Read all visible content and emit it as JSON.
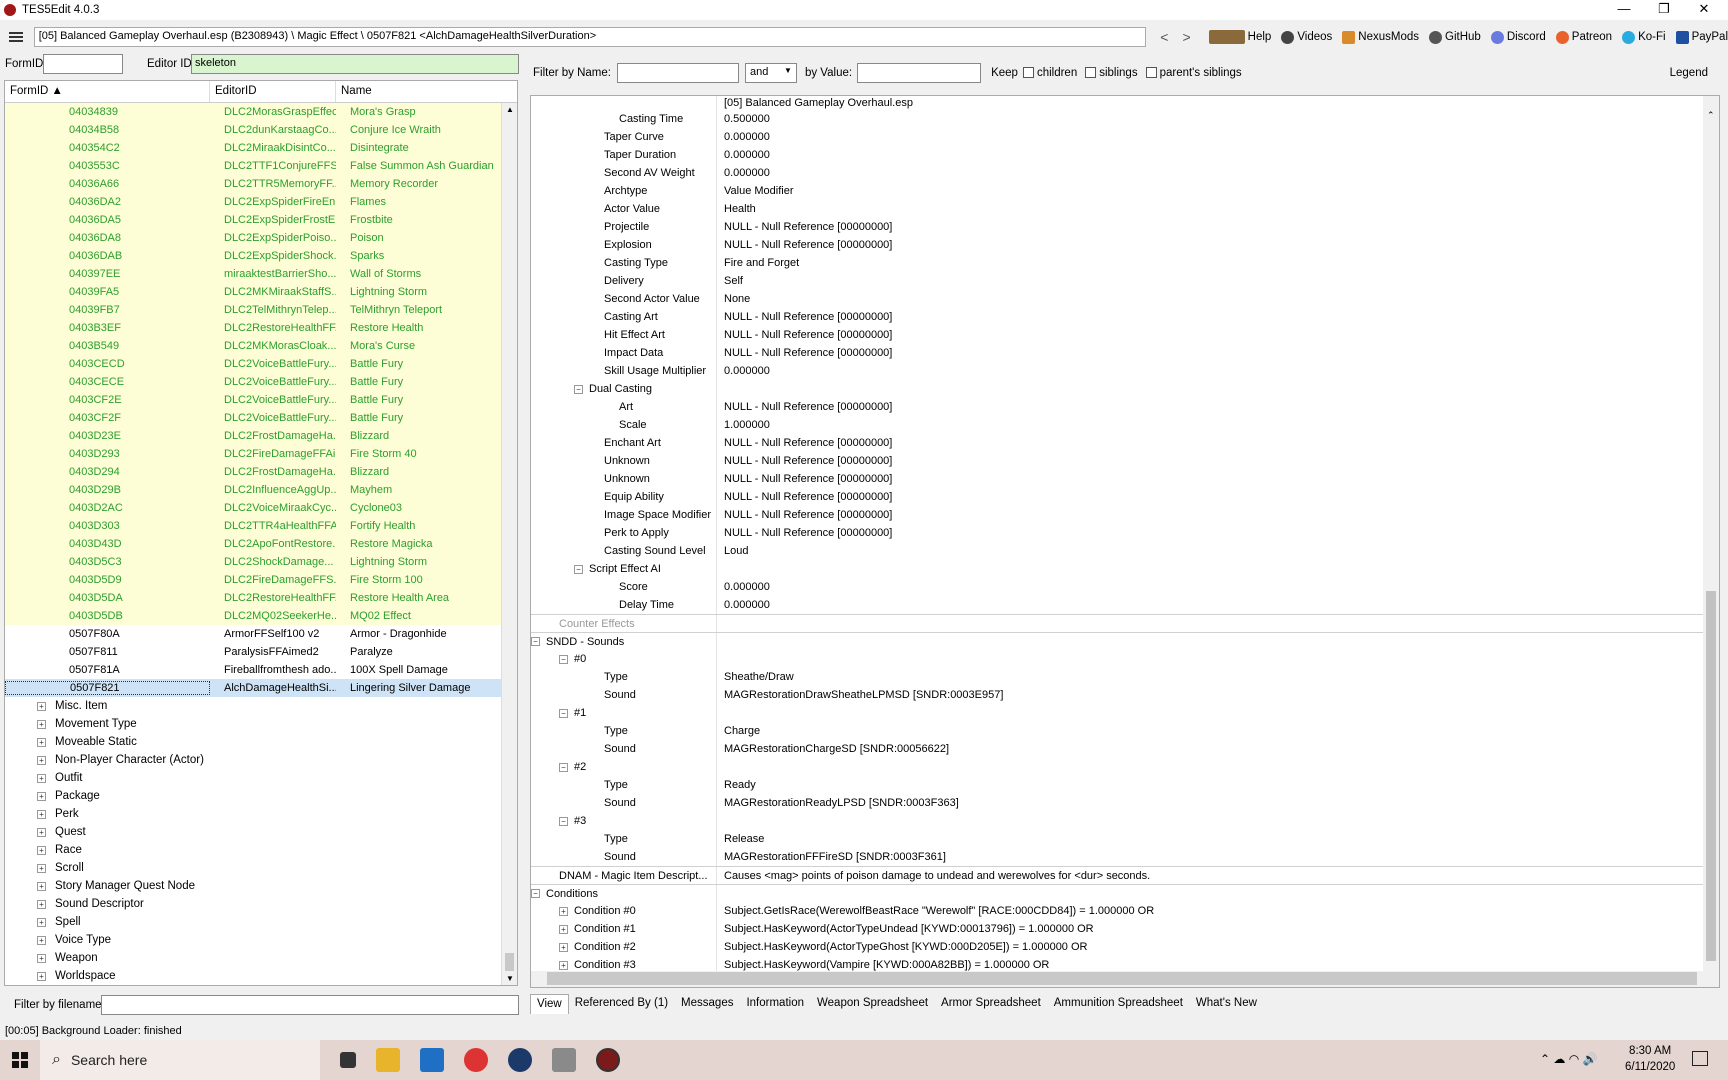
{
  "window": {
    "title": "TES5Edit 4.0.3"
  },
  "pathbar": {
    "path": "[05] Balanced Gameplay Overhaul.esp (B2308943) \\ Magic Effect \\ 0507F821 <AlchDamageHealthSilverDuration>"
  },
  "toolbar": {
    "links": [
      "Help",
      "Videos",
      "NexusMods",
      "GitHub",
      "Discord",
      "Patreon",
      "Ko-Fi",
      "PayPal"
    ]
  },
  "filters": {
    "formid_label": "FormID",
    "editorid_label": "Editor ID",
    "editorid_value": "skeleton",
    "filename_label": "Filter by filename:"
  },
  "tree": {
    "headers": [
      "FormID",
      "EditorID",
      "Name"
    ],
    "rows": [
      [
        "04034839",
        "DLC2MorasGraspEffect",
        "Mora's Grasp"
      ],
      [
        "04034B58",
        "DLC2dunKarstaagCo...",
        "Conjure Ice Wraith"
      ],
      [
        "040354C2",
        "DLC2MiraakDisintCo...",
        "Disintegrate"
      ],
      [
        "0403553C",
        "DLC2TTF1ConjureFFS...",
        "False Summon Ash Guardian"
      ],
      [
        "04036A66",
        "DLC2TTR5MemoryFF...",
        "Memory Recorder"
      ],
      [
        "04036DA2",
        "DLC2ExpSpiderFireEn...",
        "Flames"
      ],
      [
        "04036DA5",
        "DLC2ExpSpiderFrostE...",
        "Frostbite"
      ],
      [
        "04036DA8",
        "DLC2ExpSpiderPoiso...",
        "Poison"
      ],
      [
        "04036DAB",
        "DLC2ExpSpiderShock...",
        "Sparks"
      ],
      [
        "040397EE",
        "miraaktestBarrierSho...",
        "Wall of Storms"
      ],
      [
        "04039FA5",
        "DLC2MKMiraakStaffS...",
        "Lightning Storm"
      ],
      [
        "04039FB7",
        "DLC2TelMithrynTelep...",
        "TelMithryn Teleport"
      ],
      [
        "0403B3EF",
        "DLC2RestoreHealthFF...",
        "Restore Health"
      ],
      [
        "0403B549",
        "DLC2MKMorasCloak...",
        "Mora's Curse"
      ],
      [
        "0403CECD",
        "DLC2VoiceBattleFury...",
        "Battle Fury"
      ],
      [
        "0403CECE",
        "DLC2VoiceBattleFury...",
        "Battle Fury"
      ],
      [
        "0403CF2E",
        "DLC2VoiceBattleFury...",
        "Battle Fury"
      ],
      [
        "0403CF2F",
        "DLC2VoiceBattleFury...",
        "Battle Fury"
      ],
      [
        "0403D23E",
        "DLC2FrostDamageHa...",
        "Blizzard"
      ],
      [
        "0403D293",
        "DLC2FireDamageFFAi...",
        "Fire Storm 40"
      ],
      [
        "0403D294",
        "DLC2FrostDamageHa...",
        "Blizzard"
      ],
      [
        "0403D29B",
        "DLC2InfluenceAggUp...",
        "Mayhem"
      ],
      [
        "0403D2AC",
        "DLC2VoiceMiraakCyc...",
        "Cyclone03"
      ],
      [
        "0403D303",
        "DLC2TTR4aHealthFFA...",
        "Fortify Health"
      ],
      [
        "0403D43D",
        "DLC2ApoFontRestore...",
        "Restore Magicka"
      ],
      [
        "0403D5C3",
        "DLC2ShockDamage...",
        "Lightning Storm"
      ],
      [
        "0403D5D9",
        "DLC2FireDamageFFS...",
        "Fire Storm 100"
      ],
      [
        "0403D5DA",
        "DLC2RestoreHealthFF...",
        "Restore Health Area"
      ],
      [
        "0403D5DB",
        "DLC2MQ02SeekerHe...",
        "MQ02 Effect"
      ]
    ],
    "plain_rows": [
      [
        "0507F80A",
        "ArmorFFSelf100 v2",
        "Armor - Dragonhide"
      ],
      [
        "0507F811",
        "ParalysisFFAimed2",
        "Paralyze"
      ],
      [
        "0507F81A",
        "Fireballfromthesh ado...",
        "100X Spell Damage"
      ]
    ],
    "selected_row": [
      "0507F821",
      "AlchDamageHealthSi...",
      "Lingering Silver Damage"
    ],
    "groups": [
      "Misc. Item",
      "Movement Type",
      "Moveable Static",
      "Non-Player Character (Actor)",
      "Outfit",
      "Package",
      "Perk",
      "Quest",
      "Race",
      "Scroll",
      "Story Manager Quest Node",
      "Sound Descriptor",
      "Spell",
      "Voice Type",
      "Weapon",
      "Worldspace"
    ]
  },
  "rightfilter": {
    "by_name": "Filter by Name:",
    "op": "and",
    "by_value": "by Value:",
    "keep": "Keep",
    "children": "children",
    "siblings": "siblings",
    "parents_siblings": "parent's siblings",
    "legend": "Legend"
  },
  "props": {
    "file_header": "[05] Balanced Gameplay Overhaul.esp",
    "rows": [
      {
        "k": "Casting Time",
        "v": "0.500000",
        "i": 2
      },
      {
        "k": "Taper Curve",
        "v": "0.000000",
        "i": 1
      },
      {
        "k": "Taper Duration",
        "v": "0.000000",
        "i": 1
      },
      {
        "k": "Second AV Weight",
        "v": "0.000000",
        "i": 1
      },
      {
        "k": "Archtype",
        "v": "Value Modifier",
        "i": 1
      },
      {
        "k": "Actor Value",
        "v": "Health",
        "i": 1
      },
      {
        "k": "Projectile",
        "v": "NULL - Null Reference [00000000]",
        "i": 1
      },
      {
        "k": "Explosion",
        "v": "NULL - Null Reference [00000000]",
        "i": 1
      },
      {
        "k": "Casting Type",
        "v": "Fire and Forget",
        "i": 1
      },
      {
        "k": "Delivery",
        "v": "Self",
        "i": 1
      },
      {
        "k": "Second Actor Value",
        "v": "None",
        "i": 1
      },
      {
        "k": "Casting Art",
        "v": "NULL - Null Reference [00000000]",
        "i": 1
      },
      {
        "k": "Hit Effect Art",
        "v": "NULL - Null Reference [00000000]",
        "i": 1
      },
      {
        "k": "Impact Data",
        "v": "NULL - Null Reference [00000000]",
        "i": 1
      },
      {
        "k": "Skill Usage Multiplier",
        "v": "0.000000",
        "i": 1
      },
      {
        "k": "Dual Casting",
        "v": "",
        "i": 0,
        "exp": "⊟"
      },
      {
        "k": "Art",
        "v": "NULL - Null Reference [00000000]",
        "i": 2
      },
      {
        "k": "Scale",
        "v": "1.000000",
        "i": 2
      },
      {
        "k": "Enchant Art",
        "v": "NULL - Null Reference [00000000]",
        "i": 1
      },
      {
        "k": "Unknown",
        "v": "NULL - Null Reference [00000000]",
        "i": 1
      },
      {
        "k": "Unknown",
        "v": "NULL - Null Reference [00000000]",
        "i": 1
      },
      {
        "k": "Equip Ability",
        "v": "NULL - Null Reference [00000000]",
        "i": 1
      },
      {
        "k": "Image Space Modifier",
        "v": "NULL - Null Reference [00000000]",
        "i": 1
      },
      {
        "k": "Perk to Apply",
        "v": "NULL - Null Reference [00000000]",
        "i": 1
      },
      {
        "k": "Casting Sound Level",
        "v": "Loud",
        "i": 1
      },
      {
        "k": "Script Effect AI",
        "v": "",
        "i": 0,
        "exp": "⊟"
      },
      {
        "k": "Score",
        "v": "0.000000",
        "i": 2
      },
      {
        "k": "Delay Time",
        "v": "0.000000",
        "i": 2
      },
      {
        "k": "Counter Effects",
        "v": "",
        "i": -2,
        "gray": true,
        "sep": true
      },
      {
        "k": "SNDD - Sounds",
        "v": "",
        "i": -3,
        "exp": "⊟",
        "sep": true
      },
      {
        "k": "#0",
        "v": "",
        "i": -1,
        "exp": "⊟"
      },
      {
        "k": "Type",
        "v": "Sheathe/Draw",
        "i": 1
      },
      {
        "k": "Sound",
        "v": "MAGRestorationDrawSheatheLPMSD [SNDR:0003E957]",
        "i": 1
      },
      {
        "k": "#1",
        "v": "",
        "i": -1,
        "exp": "⊟"
      },
      {
        "k": "Type",
        "v": "Charge",
        "i": 1
      },
      {
        "k": "Sound",
        "v": "MAGRestorationChargeSD [SNDR:00056622]",
        "i": 1
      },
      {
        "k": "#2",
        "v": "",
        "i": -1,
        "exp": "⊟"
      },
      {
        "k": "Type",
        "v": "Ready",
        "i": 1
      },
      {
        "k": "Sound",
        "v": "MAGRestorationReadyLPSD [SNDR:0003F363]",
        "i": 1
      },
      {
        "k": "#3",
        "v": "",
        "i": -1,
        "exp": "⊟"
      },
      {
        "k": "Type",
        "v": "Release",
        "i": 1
      },
      {
        "k": "Sound",
        "v": "MAGRestorationFFFireSD [SNDR:0003F361]",
        "i": 1
      },
      {
        "k": "DNAM - Magic Item Descript...",
        "v": "Causes <mag> points of poison damage to undead and werewolves for <dur> seconds.",
        "i": -2,
        "sep": true
      },
      {
        "k": "Conditions",
        "v": "",
        "i": -3,
        "exp": "⊟",
        "sep": true
      },
      {
        "k": "Condition #0",
        "v": "Subject.GetIsRace(WerewolfBeastRace \"Werewolf\" [RACE:000CDD84]) = 1.000000 OR",
        "i": -1,
        "exp": "⊞"
      },
      {
        "k": "Condition #1",
        "v": "Subject.HasKeyword(ActorTypeUndead [KYWD:00013796]) = 1.000000 OR",
        "i": -1,
        "exp": "⊞"
      },
      {
        "k": "Condition #2",
        "v": "Subject.HasKeyword(ActorTypeGhost [KYWD:000D205E]) = 1.000000 OR",
        "i": -1,
        "exp": "⊞"
      },
      {
        "k": "Condition #3",
        "v": "Subject.HasKeyword(Vampire [KYWD:000A82BB]) = 1.000000 OR",
        "i": -1,
        "exp": "⊞"
      }
    ]
  },
  "tabs": [
    "View",
    "Referenced By (1)",
    "Messages",
    "Information",
    "Weapon Spreadsheet",
    "Armor Spreadsheet",
    "Ammunition Spreadsheet",
    "What's New"
  ],
  "status": "[00:05] Background Loader: finished",
  "taskbar": {
    "search_placeholder": "Search here",
    "time": "8:30 AM",
    "date": "6/11/2020"
  }
}
